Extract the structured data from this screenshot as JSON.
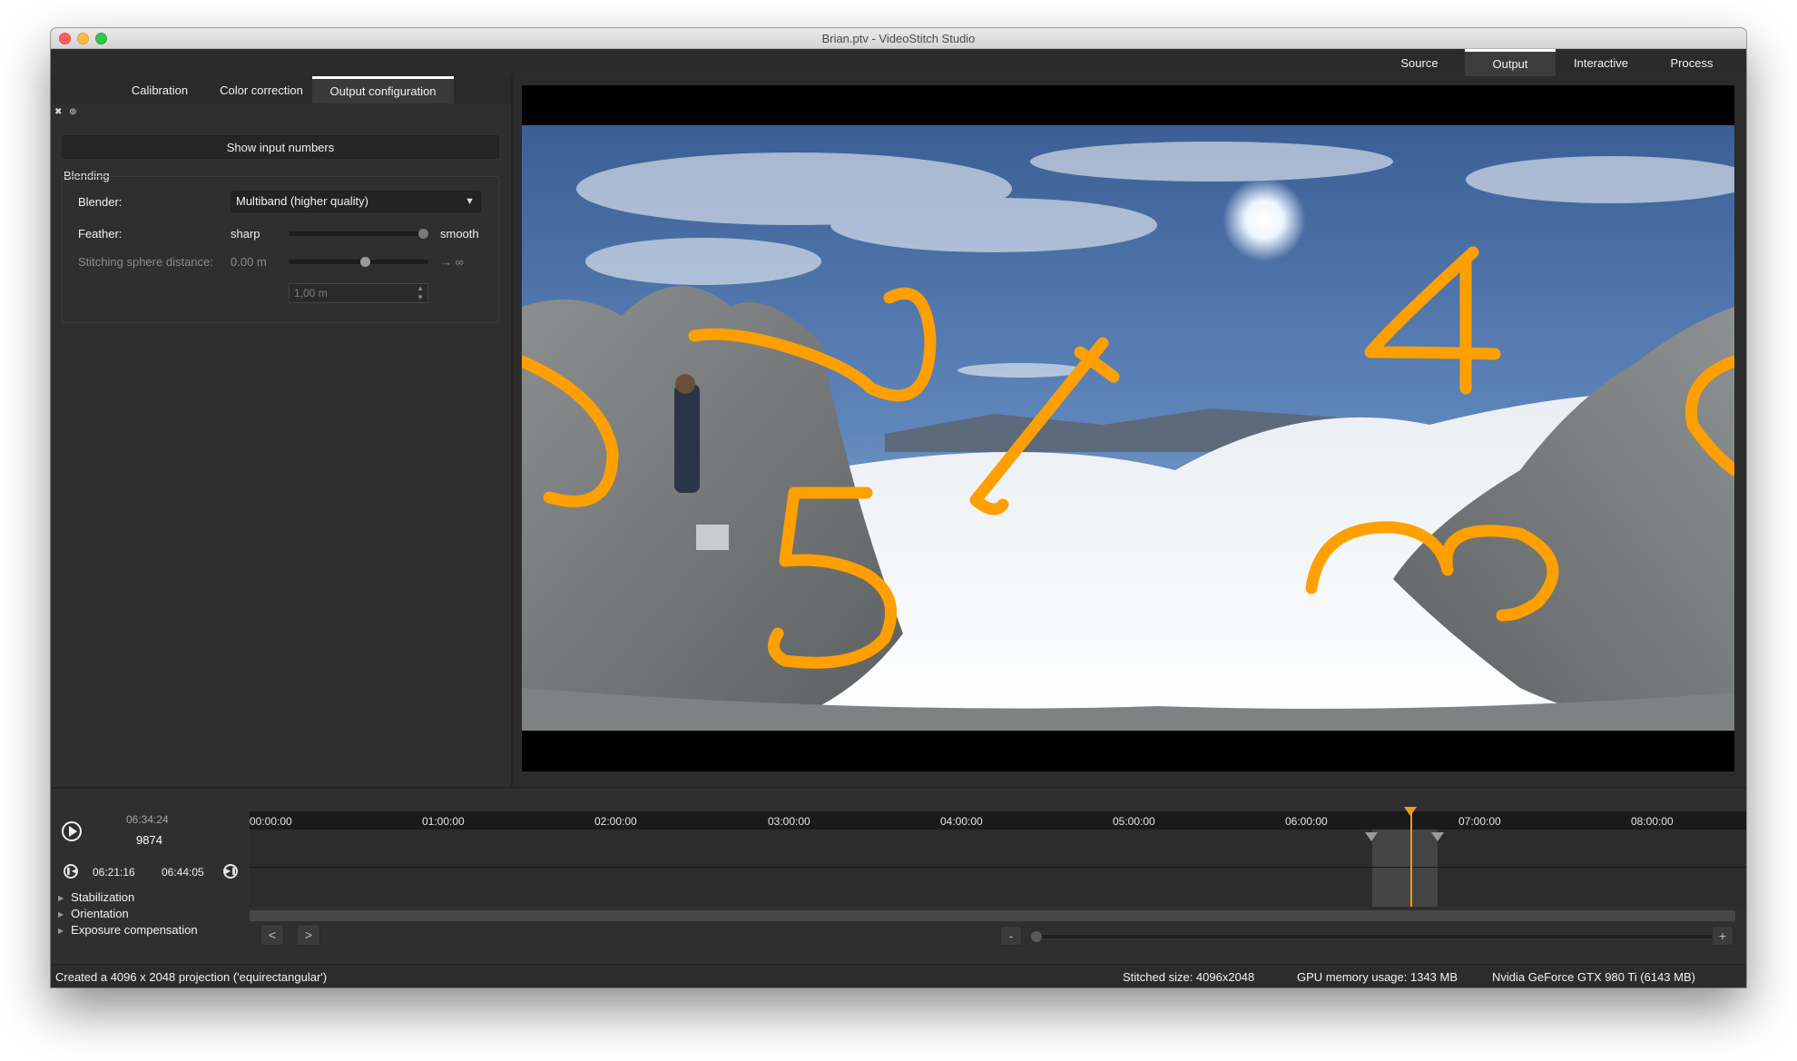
{
  "window": {
    "title": "Brian.ptv - VideoStitch Studio"
  },
  "mode_tabs": [
    {
      "label": "Source"
    },
    {
      "label": "Output",
      "active": true
    },
    {
      "label": "Interactive"
    },
    {
      "label": "Process"
    }
  ],
  "sub_tabs": [
    {
      "label": "Calibration"
    },
    {
      "label": "Color correction"
    },
    {
      "label": "Output configuration",
      "active": true
    }
  ],
  "panel": {
    "icons": [
      "close-icon",
      "link-icon"
    ],
    "show_input_numbers": "Show input numbers",
    "blending": {
      "title": "Blending",
      "blender_label": "Blender:",
      "blender_value": "Multiband (higher quality)",
      "feather_label": "Feather:",
      "feather_min": "sharp",
      "feather_max": "smooth",
      "feather_level": 1.0,
      "sphere_label": "Stitching sphere distance:",
      "sphere_value": "0.00 m",
      "sphere_max": "→ ∞",
      "sphere_level": 0.55,
      "sphere_input": "1,00 m"
    }
  },
  "overlay_numbers": [
    "1",
    "2",
    "3",
    "4",
    "5"
  ],
  "overlay_color": "#ffa000",
  "timeline": {
    "current_timecode": "06:34:24",
    "current_frame": "9874",
    "in_point": "06:21:16",
    "out_point": "06:44:05",
    "ruler_labels": [
      "00:00:00",
      "01:00:00",
      "02:00:00",
      "03:00:00",
      "04:00:00",
      "05:00:00",
      "06:00:00",
      "07:00:00",
      "08:00:00"
    ],
    "tree": [
      "Stabilization",
      "Orientation",
      "Exposure compensation"
    ],
    "nav_prev": "<",
    "nav_next": ">",
    "zoom_out": "-",
    "zoom_in": "+"
  },
  "status": {
    "message": "Created a 4096 x 2048 projection ('equirectangular')",
    "stitched_size": "Stitched size: 4096x2048",
    "gpu_memory": "GPU memory usage: 1343 MB",
    "gpu_name": "Nvidia GeForce GTX 980 Ti (6143 MB)"
  },
  "colors": {
    "accent": "#f39c12",
    "background": "#2f2f2f"
  }
}
